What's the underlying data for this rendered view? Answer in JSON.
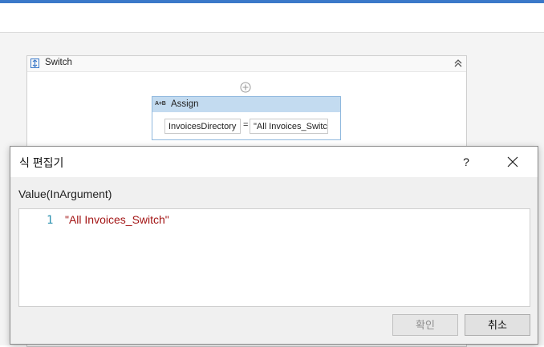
{
  "workflow": {
    "switch_title": "Switch",
    "assign": {
      "title": "Assign",
      "icon_text": "A+B",
      "to_value": "InvoicesDirectory",
      "equals": "=",
      "value_value": "\"All Invoices_Switc"
    }
  },
  "dialog": {
    "title": "식 편집기",
    "help_label": "?",
    "argument_label": "Value(InArgument)",
    "editor": {
      "lines": [
        {
          "number": "1",
          "text": "\"All Invoices_Switch\""
        }
      ]
    },
    "ok_label": "확인",
    "cancel_label": "취소"
  },
  "icons": {
    "switch": "switch-icon",
    "collapse": "double-chevron-up-icon",
    "add": "plus-circle-icon",
    "close": "close-icon"
  },
  "colors": {
    "accent": "#3b79c9",
    "assign_header": "#c3dbf0",
    "string_literal": "#a31515",
    "line_number": "#2b91af"
  }
}
